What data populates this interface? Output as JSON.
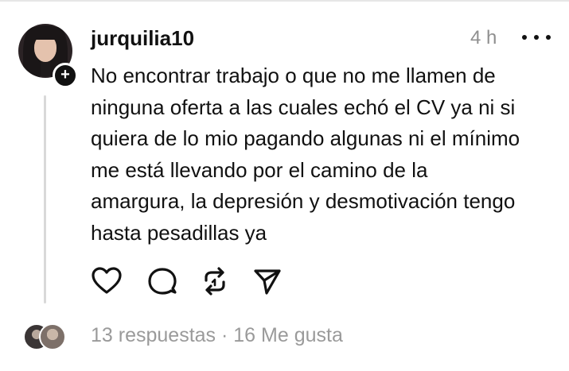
{
  "post": {
    "username": "jurquilia10",
    "timestamp": "4 h",
    "follow_badge": "+",
    "avatar_icon": "profile-photo",
    "more_icon": "more-options-icon",
    "body_lines": [
      "No encontrar trabajo o que no me llamen de",
      "ninguna oferta a las cuales echó el CV ya ni si",
      "quiera de lo mio pagando algunas ni el mínimo",
      "me está llevando por el camino de la",
      "amargura, la depresión y desmotivación tengo",
      "hasta pesadillas ya"
    ],
    "actions": [
      "heart-icon",
      "comment-icon",
      "repost-icon",
      "share-icon"
    ]
  },
  "footer": {
    "replies": "13 respuestas",
    "separator": " · ",
    "likes": "16 Me gusta"
  },
  "colors": {
    "text_primary": "#111111",
    "text_secondary": "#9a9a9a",
    "thread_line": "#d9d9d9"
  }
}
